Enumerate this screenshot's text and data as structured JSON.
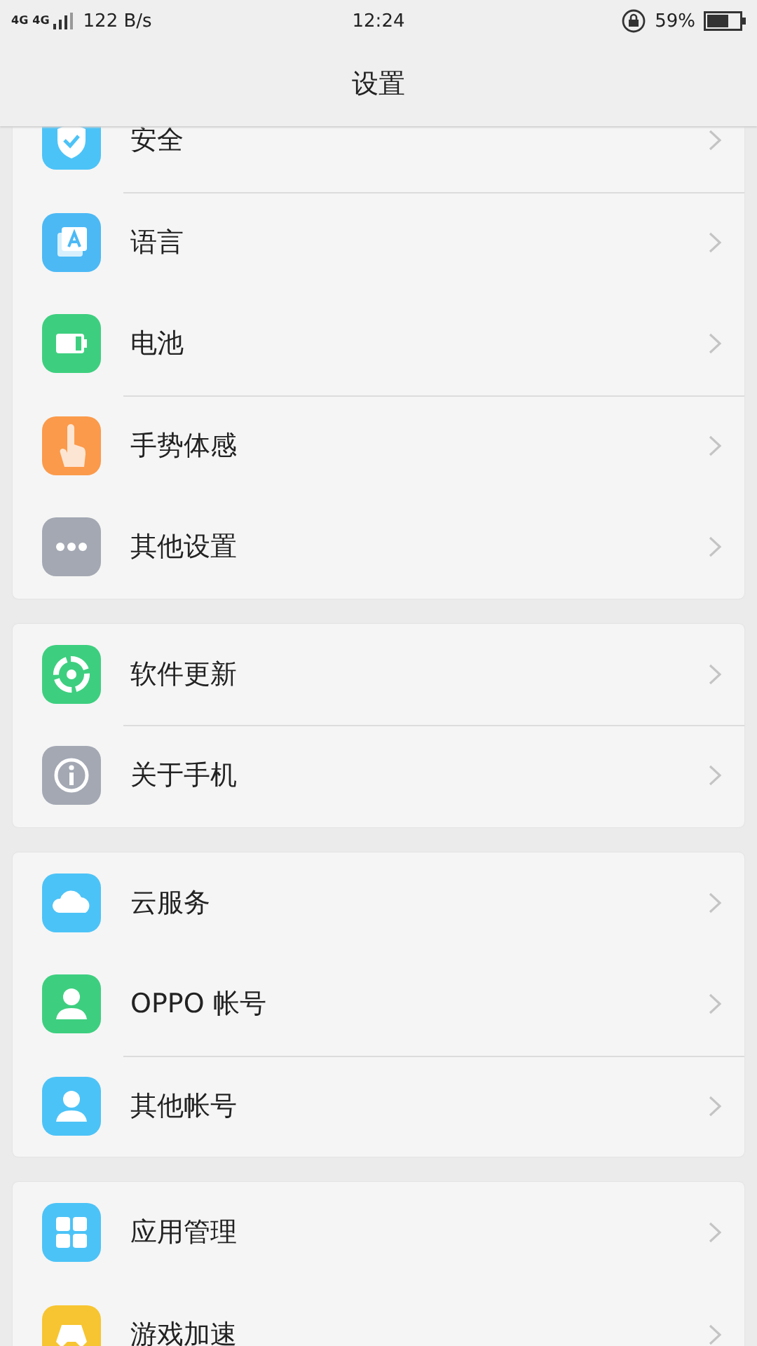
{
  "status_bar": {
    "network_1": "4G",
    "network_2": "4G",
    "speed": "122 B/s",
    "time": "12:24",
    "battery": "59%"
  },
  "header": {
    "title": "设置"
  },
  "groups": [
    {
      "items": [
        {
          "label": "安全",
          "kind": "shield",
          "color": "#4cc3f7"
        },
        {
          "label": "语言",
          "kind": "language",
          "color": "#4cb9f5",
          "divider_above": true
        },
        {
          "label": "电池",
          "kind": "battery",
          "color": "#3dcf7f",
          "divider_above": false
        },
        {
          "label": "手势体感",
          "kind": "gesture",
          "color": "#fb9a4a",
          "divider_above": true
        },
        {
          "label": "其他设置",
          "kind": "more",
          "color": "#a3a8b3",
          "divider_above": false
        }
      ]
    },
    {
      "items": [
        {
          "label": "软件更新",
          "kind": "update",
          "color": "#3dcf7f",
          "divider_above": false
        },
        {
          "label": "关于手机",
          "kind": "info",
          "color": "#a3a8b3",
          "divider_above": true
        }
      ]
    },
    {
      "items": [
        {
          "label": "云服务",
          "kind": "cloud",
          "color": "#4cc3f7",
          "divider_above": false
        },
        {
          "label": "OPPO 帐号",
          "kind": "person",
          "color": "#3dcf7f",
          "divider_above": false
        },
        {
          "label": "其他帐号",
          "kind": "person",
          "color": "#4cc3f7",
          "divider_above": true
        }
      ]
    },
    {
      "items": [
        {
          "label": "应用管理",
          "kind": "apps",
          "color": "#4cc3f7",
          "divider_above": false
        },
        {
          "label": "游戏加速",
          "kind": "game",
          "color": "#f7c531",
          "divider_above": false
        }
      ]
    }
  ]
}
